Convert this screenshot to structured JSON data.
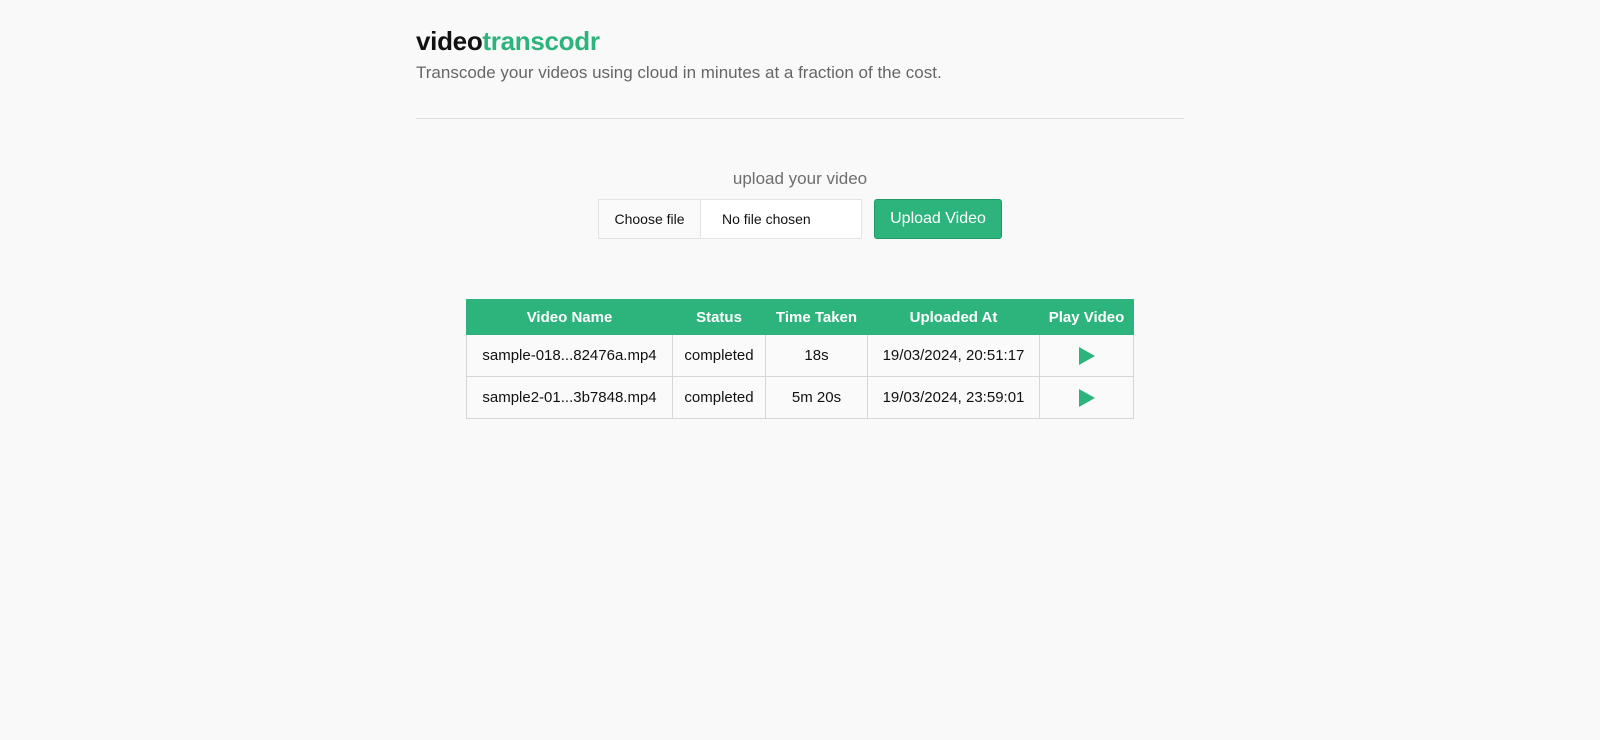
{
  "brand": {
    "part1": "video",
    "part2": "transcodr"
  },
  "tagline": "Transcode your videos using cloud in minutes at a fraction of the cost.",
  "upload": {
    "label": "upload your video",
    "choose_file": "Choose file",
    "file_status": "No file chosen",
    "upload_button": "Upload Video"
  },
  "table": {
    "headers": [
      "Video Name",
      "Status",
      "Time Taken",
      "Uploaded At",
      "Play Video"
    ],
    "rows": [
      {
        "name": "sample-018...82476a.mp4",
        "status": "completed",
        "time": "18s",
        "uploaded": "19/03/2024, 20:51:17",
        "play_icon": "play-icon"
      },
      {
        "name": "sample2-01...3b7848.mp4",
        "status": "completed",
        "time": "5m 20s",
        "uploaded": "19/03/2024, 23:59:01",
        "play_icon": "play-icon"
      }
    ]
  },
  "colors": {
    "accent": "#2db47c",
    "background": "#f9f9f9"
  }
}
